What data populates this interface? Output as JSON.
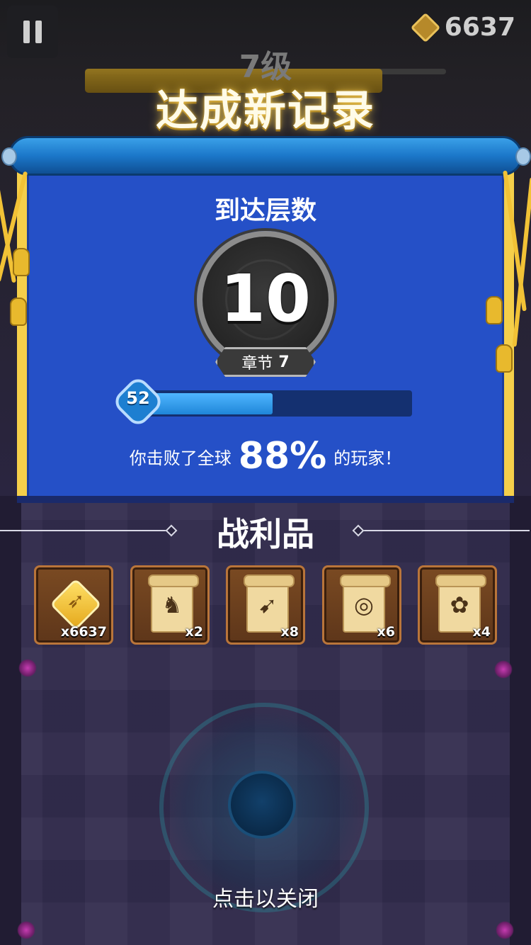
{
  "hud": {
    "pause_icon": "pause-icon",
    "coin_icon": "bow-coin-icon",
    "coins": "6637",
    "level_label": "7级"
  },
  "banner": {
    "title": "达成新记录"
  },
  "result": {
    "floors_label": "到达层数",
    "floor_number": "10",
    "chapter_label": "章节",
    "chapter_number": "7",
    "player_level": "52",
    "xp_progress": 0.49,
    "defeat_prefix": "你击败了全球",
    "defeat_percent": "88%",
    "defeat_suffix": "的玩家！"
  },
  "loot": {
    "title": "战利品",
    "items": [
      {
        "icon": "bow-coin-icon",
        "glyph": "➶",
        "qty": "x6637"
      },
      {
        "icon": "armor-scroll-icon",
        "glyph": "♞",
        "qty": "x2"
      },
      {
        "icon": "bow-scroll-icon",
        "glyph": "➹",
        "qty": "x8"
      },
      {
        "icon": "ring-scroll-icon",
        "glyph": "◎",
        "qty": "x6"
      },
      {
        "icon": "paw-scroll-icon",
        "glyph": "✿",
        "qty": "x4"
      }
    ]
  },
  "footer": {
    "close_hint": "点击以关闭"
  },
  "colors": {
    "panel_blue": "#2550c7",
    "panel_trim": "#f5cf4a",
    "record_glow": "#ffd65a"
  }
}
